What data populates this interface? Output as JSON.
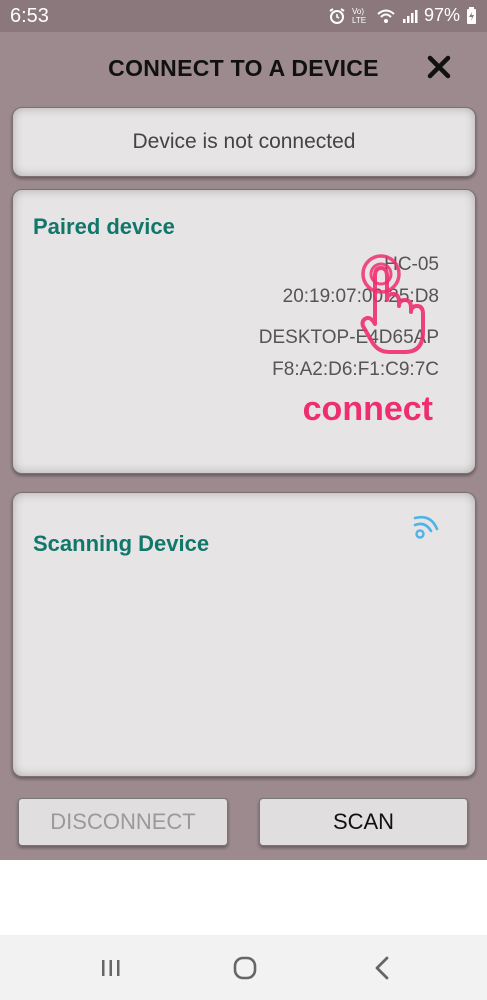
{
  "status_bar": {
    "time": "6:53",
    "network_label": "Vo) LTE",
    "battery": "97%"
  },
  "header": {
    "title": "CONNECT TO A DEVICE"
  },
  "connection": {
    "status_text": "Device is not connected"
  },
  "paired": {
    "title": "Paired device",
    "devices": [
      {
        "name": "HC-05",
        "address": "20:19:07:00:25:D8"
      },
      {
        "name": "DESKTOP-E4D65AP",
        "address": "F8:A2:D6:F1:C9:7C"
      }
    ],
    "hint_label": "connect"
  },
  "scanning": {
    "title": "Scanning Device"
  },
  "buttons": {
    "disconnect": "DISCONNECT",
    "scan": "SCAN"
  },
  "colors": {
    "accent_green": "#11776a",
    "hint_pink": "#ee2e70",
    "wifi_blue": "#4fb3e8"
  },
  "icons": {
    "close": "close-icon",
    "hand": "tap-hand-icon",
    "wifi": "wifi-scan-icon"
  }
}
